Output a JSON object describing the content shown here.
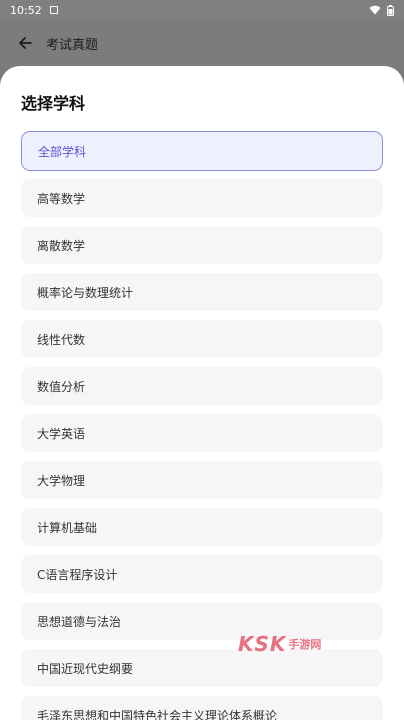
{
  "status_bar": {
    "time": "10:52",
    "icons": [
      "notification-icon",
      "wifi-icon",
      "battery-icon"
    ]
  },
  "app_bar": {
    "title": "考试真题",
    "back_icon": "arrow-left-icon"
  },
  "sheet": {
    "title": "选择学科",
    "selected_index": 0,
    "options": [
      "全部学科",
      "高等数学",
      "离散数学",
      "概率论与数理统计",
      "线性代数",
      "数值分析",
      "大学英语",
      "大学物理",
      "计算机基础",
      "C语言程序设计",
      "思想道德与法治",
      "中国近现代史纲要",
      "毛泽东思想和中国特色社会主义理论体系概论"
    ]
  },
  "watermark": {
    "brand": "KSK",
    "text": "手游网"
  },
  "colors": {
    "accent": "#5a55d8",
    "accent_border": "#8f8fe3",
    "selected_bg": "#eef0fd",
    "option_bg": "#f6f6f8",
    "overlay": "#7c7c7c",
    "watermark": "#e5586b"
  }
}
